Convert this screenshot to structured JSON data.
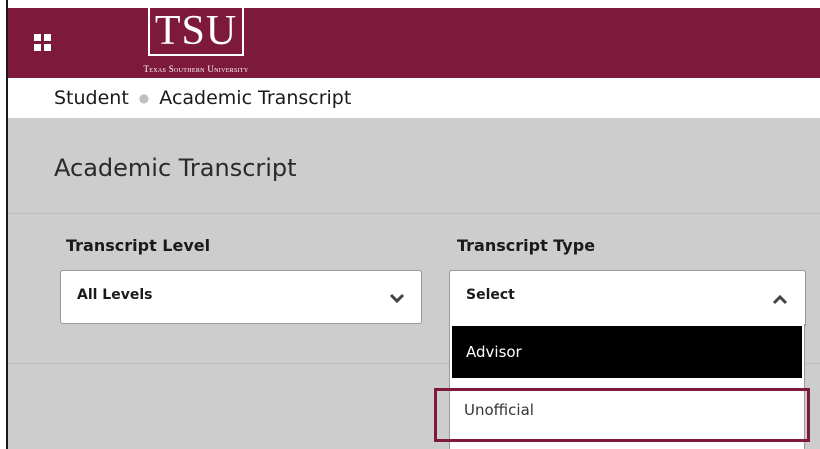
{
  "header": {
    "logo_text": "TSU",
    "logo_subtitle": "Texas Southern University",
    "menu_icon": "grid-menu-icon",
    "brand_color": "#7d1a3c"
  },
  "breadcrumb": {
    "items": [
      "Student",
      "Academic Transcript"
    ]
  },
  "page": {
    "title": "Academic Transcript"
  },
  "filters": {
    "level": {
      "label": "Transcript Level",
      "value": "All Levels",
      "icon": "chevron-down-icon"
    },
    "type": {
      "label": "Transcript Type",
      "value": "Select",
      "icon": "chevron-up-icon",
      "options": [
        "Advisor",
        "Unofficial"
      ],
      "active_option": "Advisor",
      "highlighted_option": "Unofficial"
    }
  }
}
